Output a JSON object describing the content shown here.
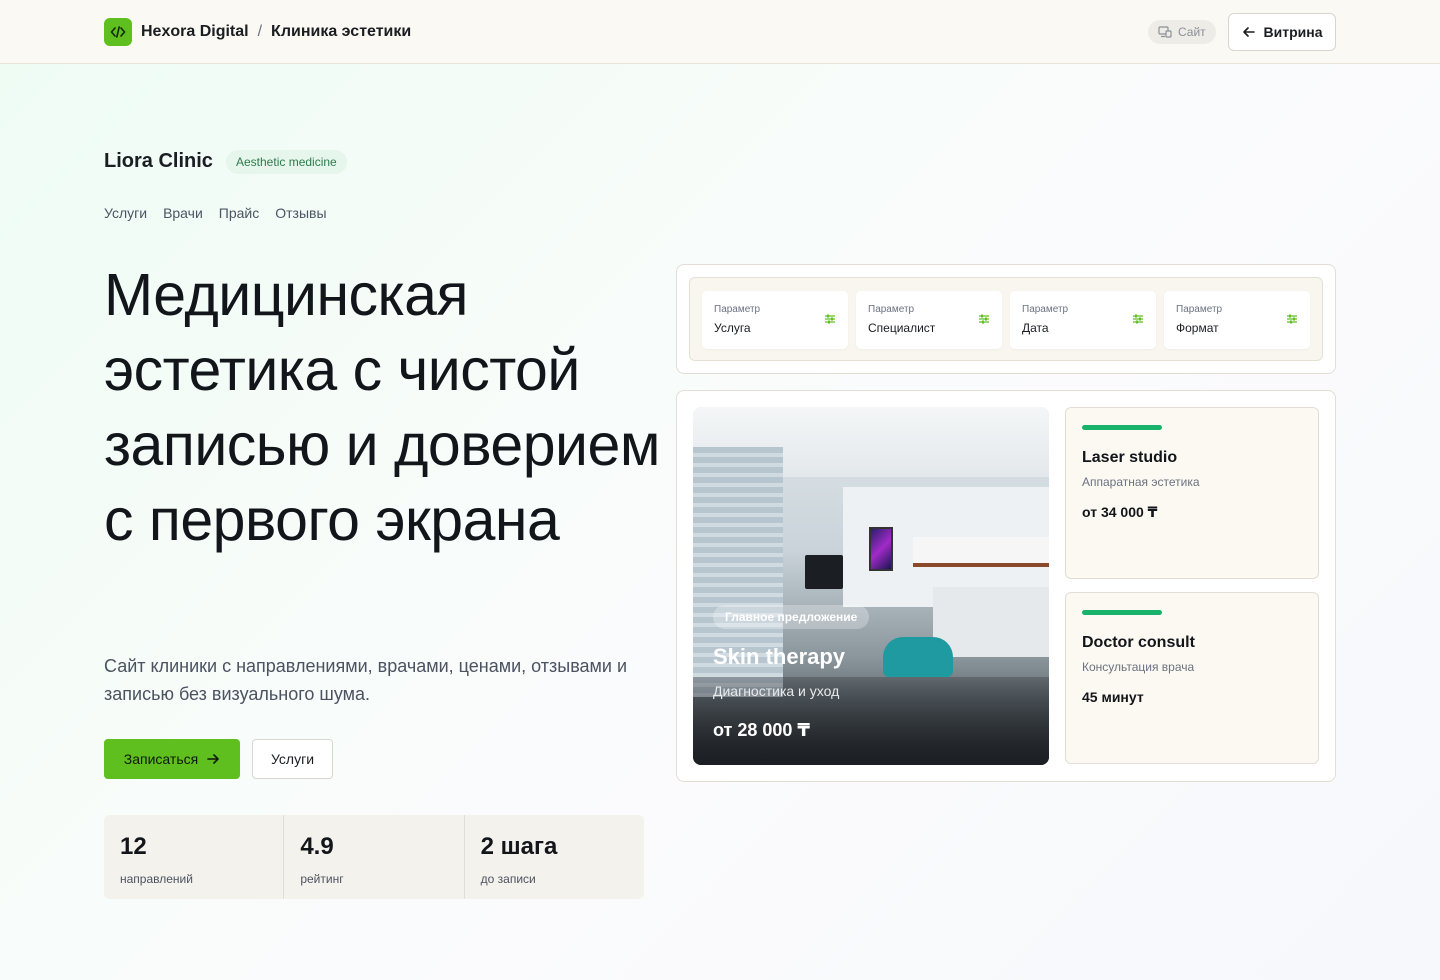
{
  "topbar": {
    "brand_name": "Hexora Digital",
    "separator": "/",
    "page_name": "Клиника эстетики",
    "site_label": "Сайт",
    "showcase_label": "Витрина"
  },
  "clinic": {
    "name": "Liora Clinic",
    "tag": "Aesthetic medicine",
    "nav": [
      "Услуги",
      "Врачи",
      "Прайс",
      "Отзывы"
    ]
  },
  "hero": {
    "title": "Медицинская эстетика с чистой записью и доверием с первого экрана",
    "subtitle": "Сайт клиники с направлениями, врачами, ценами, отзывами и записью без визуального шума.",
    "primary_cta": "Записаться",
    "secondary_cta": "Услуги"
  },
  "stats": [
    {
      "value": "12",
      "label": "направлений"
    },
    {
      "value": "4.9",
      "label": "рейтинг"
    },
    {
      "value": "2 шага",
      "label": "до записи"
    }
  ],
  "filters": [
    {
      "label": "Параметр",
      "value": "Услуга"
    },
    {
      "label": "Параметр",
      "value": "Специалист"
    },
    {
      "label": "Параметр",
      "value": "Дата"
    },
    {
      "label": "Параметр",
      "value": "Формат"
    }
  ],
  "feature": {
    "badge": "Главное предложение",
    "title": "Skin therapy",
    "subtitle": "Диагностика и уход",
    "price": "от 28 000 ₸"
  },
  "services": [
    {
      "title": "Laser studio",
      "subtitle": "Аппаратная эстетика",
      "price": "от 34 000 ₸"
    },
    {
      "title": "Doctor consult",
      "subtitle": "Консультация врача",
      "price": "45 минут"
    }
  ],
  "colors": {
    "accent_green": "#5fbf1f",
    "service_bar": "#18b26b"
  }
}
